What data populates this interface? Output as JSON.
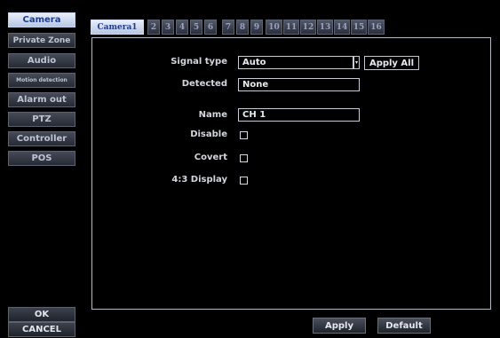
{
  "sidebar": {
    "items": [
      {
        "label": "Camera"
      },
      {
        "label": "Private Zone"
      },
      {
        "label": "Audio"
      },
      {
        "label": "Motion detection"
      },
      {
        "label": "Alarm out"
      },
      {
        "label": "PTZ"
      },
      {
        "label": "Controller"
      },
      {
        "label": "POS"
      }
    ],
    "ok_label": "OK",
    "cancel_label": "CANCEL"
  },
  "tabs": [
    "Camera1",
    "2",
    "3",
    "4",
    "5",
    "6",
    "7",
    "8",
    "9",
    "10",
    "11",
    "12",
    "13",
    "14",
    "15",
    "16"
  ],
  "form": {
    "signal_type_label": "Signal type",
    "signal_type_value": "Auto",
    "apply_all_label": "Apply All",
    "detected_label": "Detected",
    "detected_value": "None",
    "name_label": "Name",
    "name_value": "CH 1",
    "disable_label": "Disable",
    "covert_label": "Covert",
    "display43_label": "4:3 Display"
  },
  "footer": {
    "apply_label": "Apply",
    "default_label": "Default"
  }
}
